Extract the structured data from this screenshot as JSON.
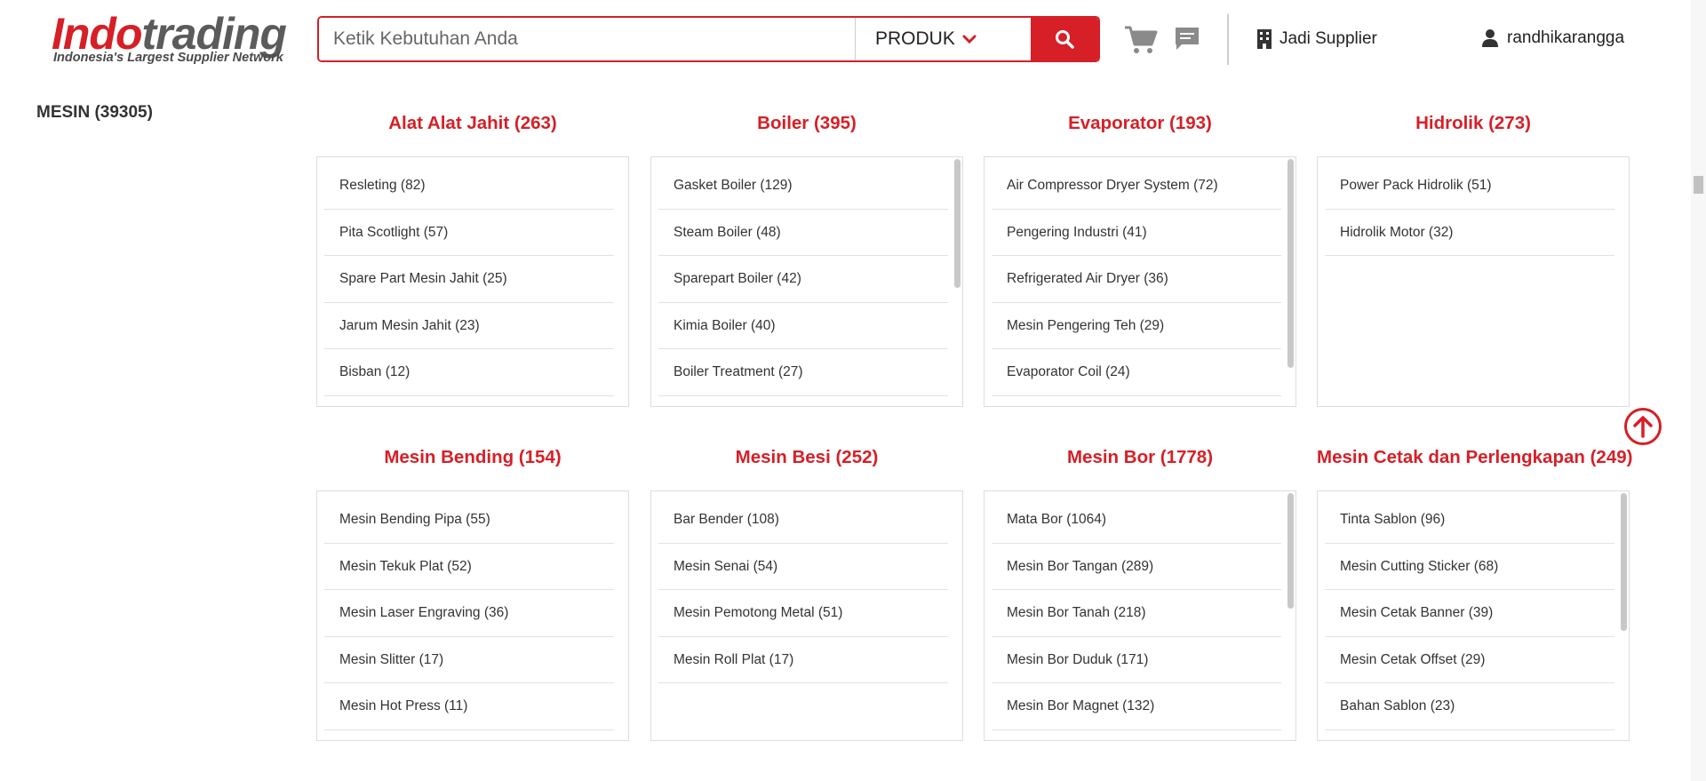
{
  "header": {
    "logo_part1": "Indo",
    "logo_part2": "trading",
    "logo_tagline": "Indonesia's Largest Supplier Network",
    "search_placeholder": "Ketik Kebutuhan Anda",
    "search_type": "PRODUK",
    "supplier_link": "Jadi Supplier",
    "username": "randhikarangga",
    "accent_color": "#d61f26"
  },
  "sidebar": {
    "title": "MESIN (39305)"
  },
  "categories": [
    {
      "title": "Alat Alat Jahit (263)",
      "items": [
        "Resleting (82)",
        "Pita Scotlight (57)",
        "Spare Part Mesin Jahit (25)",
        "Jarum Mesin Jahit (23)",
        "Bisban (12)"
      ]
    },
    {
      "title": "Boiler (395)",
      "items": [
        "Gasket Boiler (129)",
        "Steam Boiler (48)",
        "Sparepart Boiler (42)",
        "Kimia Boiler (40)",
        "Boiler Treatment (27)"
      ]
    },
    {
      "title": "Evaporator (193)",
      "items": [
        "Air Compressor Dryer System (72)",
        "Pengering Industri (41)",
        "Refrigerated Air Dryer (36)",
        "Mesin Pengering Teh (29)",
        "Evaporator Coil (24)"
      ]
    },
    {
      "title": "Hidrolik (273)",
      "items": [
        "Power Pack Hidrolik (51)",
        "Hidrolik Motor (32)"
      ]
    },
    {
      "title": "Mesin Bending (154)",
      "items": [
        "Mesin Bending Pipa (55)",
        "Mesin Tekuk Plat (52)",
        "Mesin Laser Engraving (36)",
        "Mesin Slitter (17)",
        "Mesin Hot Press (11)"
      ]
    },
    {
      "title": "Mesin Besi (252)",
      "items": [
        "Bar Bender (108)",
        "Mesin Senai (54)",
        "Mesin Pemotong Metal (51)",
        "Mesin Roll Plat (17)"
      ]
    },
    {
      "title": "Mesin Bor (1778)",
      "items": [
        "Mata Bor (1064)",
        "Mesin Bor Tangan (289)",
        "Mesin Bor Tanah (218)",
        "Mesin Bor Duduk (171)",
        "Mesin Bor Magnet (132)"
      ]
    },
    {
      "title": "Mesin Cetak dan Perlengkapan (249)",
      "items": [
        "Tinta Sablon (96)",
        "Mesin Cutting Sticker (68)",
        "Mesin Cetak Banner (39)",
        "Mesin Cetak Offset (29)",
        "Bahan Sablon (23)"
      ]
    }
  ]
}
